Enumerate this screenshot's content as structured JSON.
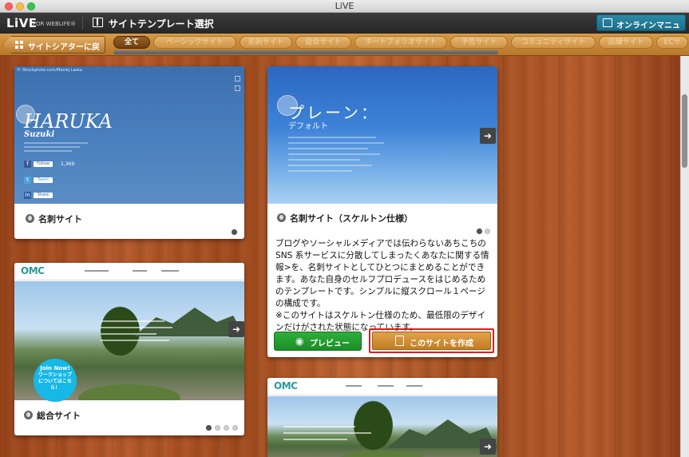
{
  "window": {
    "title": "LiVE"
  },
  "toolbar": {
    "logo": "LiVE",
    "logo_sub": "FOR WEBLIFE®",
    "title": "サイトテンプレート選択",
    "manual_label": "オンラインマニュアル"
  },
  "catbar": {
    "back_label": "サイトシアターに戻る",
    "categories": [
      "全て",
      "ベーシックサイト",
      "名刺サイト",
      "総合サイト",
      "ポートフォリオサイト",
      "予告サイト",
      "コミュニティサイト",
      "店舗サイト",
      "ECサ"
    ]
  },
  "cards": {
    "haruka": {
      "photo_credit": "© iStockphoto.com/Maciej Laska",
      "name": "HARUKA",
      "surname": "Suzuki",
      "count": "1,369",
      "like_label": "Follow",
      "tweet_label": "Tweet",
      "share_label": "Share",
      "label": "名刺サイト"
    },
    "plain": {
      "heading": "プレーン：",
      "subheading": "デフォルト",
      "label": "名刺サイト（スケルトン仕様）",
      "description": "ブログやソーシャルメディアでは伝わらないあちこちのSNS 系サービスに分散してしまったくあなたに関する情報>を、名刺サイトとしてひとつにまとめることができます。あなた自身のセルフプロデュースをはじめるためのテンプレートです。シンプルに縦スクロール１ページの構成です。\n※このサイトはスケルトン仕様のため、最低限のデザインだけがされた状態になっています。",
      "preview_label": "プレビュー",
      "create_label": "このサイトを作成"
    },
    "omc1": {
      "logo": "OMC",
      "badge": "Join Now!",
      "badge_text": "ワークショップについてはこちら！",
      "label": "総合サイト"
    },
    "omc2": {
      "logo": "OMC"
    }
  }
}
